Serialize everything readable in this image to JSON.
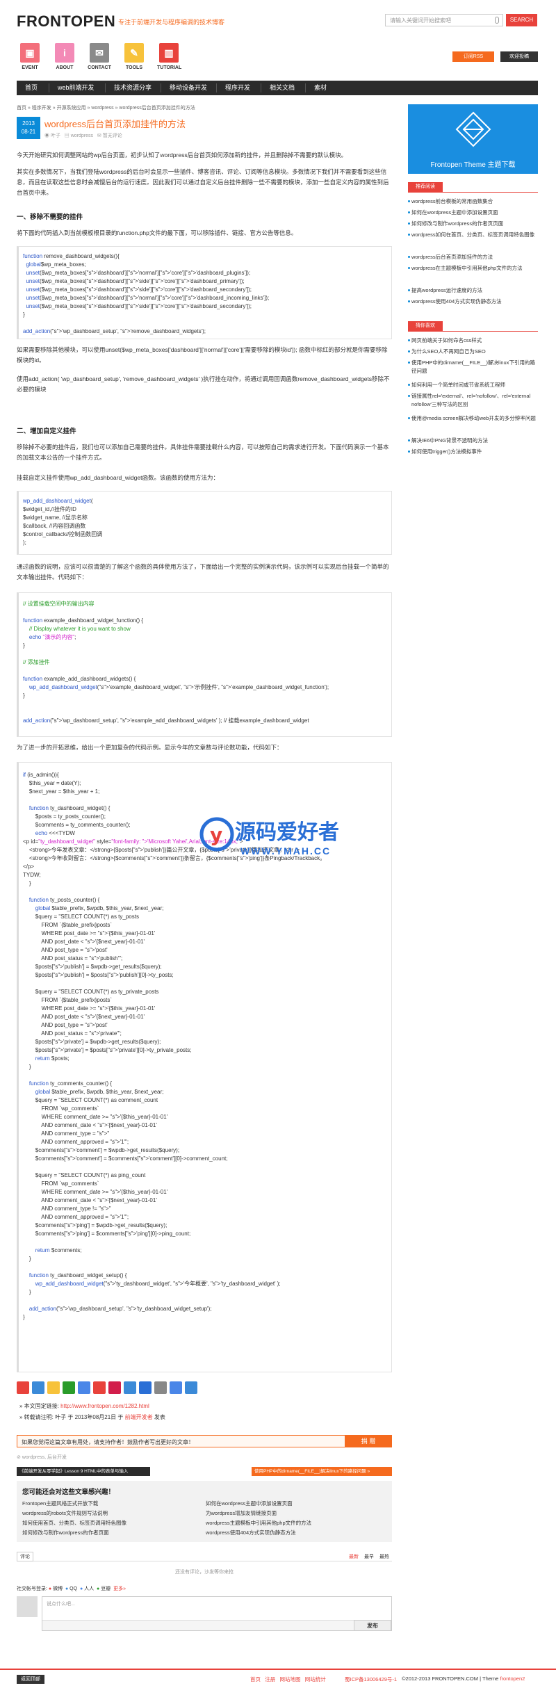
{
  "site": {
    "logo": "FRONTOPEN",
    "slogan": "专注于前端开发与程序编调的技术博客",
    "search_placeholder": "请输入关键词开始搜索吧",
    "search_btn": "SEARCH",
    "rss_btn": "订阅RSS",
    "contrib_btn": "欢迎投稿"
  },
  "icons": [
    {
      "label": "EVENT",
      "glyph": "▣",
      "color": "#f36f7b"
    },
    {
      "label": "ABOUT",
      "glyph": "i",
      "color": "#f38ab6"
    },
    {
      "label": "CONTACT",
      "glyph": "✉",
      "color": "#8a8a8a"
    },
    {
      "label": "TOOLS",
      "glyph": "✎",
      "color": "#f7c23b"
    },
    {
      "label": "TUTORIAL",
      "glyph": "▥",
      "color": "#e8423b"
    }
  ],
  "nav": [
    "首页",
    "web前端开发",
    "技术资源分享",
    "移动设备开发",
    "程序开发",
    "相关文档",
    "素材"
  ],
  "breadcrumb": "首页 » 程序开发 » 开源系统应用 » wordpress » wordpress后台首页添加挂件的方法",
  "post": {
    "year": "2013",
    "date": "08-21",
    "title": "wordpress后台首页添加挂件的方法",
    "author": "叶子",
    "category": "wordpress",
    "comments": "暂无评论"
  },
  "content": {
    "p1": "今天开始研究如何调整网站的wp后台页面，初步认知了wordpress后台首页如何添加新的挂件，并且删除掉不需要的默认模块。",
    "p2": "其实在多数情况下，当我们登陆wordpress的后台时会显示一些插件、博客咨讯、评论、订阅等信息模块。多数情况下我们并不需要看到这些信息，而且在读取这些信息时会减慢后台的运行速度。因此我们可以通过自定义后台挂件删除一些不需要的模块，添加一些自定义内容的属性到后台首页中来。",
    "h1": "一、移除不需要的挂件",
    "p3": "将下面的代码插入到当前模板根目录的function.php文件的最下面，可以移除插件、链接、官方公告等信息。",
    "code1": [
      "function remove_dashboard_widgets(){",
      "  global$wp_meta_boxes;",
      "  unset($wp_meta_boxes['dashboard']['normal']['core']['dashboard_plugins']);",
      "  unset($wp_meta_boxes['dashboard']['side']['core']['dashboard_primary']);",
      "  unset($wp_meta_boxes['dashboard']['side']['core']['dashboard_secondary']);",
      "  unset($wp_meta_boxes['dashboard']['normal']['core']['dashboard_incoming_links']);",
      "  unset($wp_meta_boxes['dashboard']['side']['core']['dashboard_secondary']);",
      "}",
      "",
      "add_action('wp_dashboard_setup', 'remove_dashboard_widgets');"
    ],
    "p4": "如果需要移除其他模块，可以使用unset($wp_meta_boxes['dashboard']['normal']['core']['需要移除的模块id']); 函数中标红的部分就是你需要移除模块的id。",
    "p5": "使用add_action( 'wp_dashboard_setup', 'remove_dashboard_widgets' )执行挂在动作，将通过调用回调函数remove_dashboard_widgets移除不必要的模块",
    "h2": "二、增加自定义挂件",
    "p6": "移除掉不必要的挂件后，我们也可以添加自己需要的挂件。具体挂件需要挂载什么内容，可以按照自己的需求进行开发。下面代码演示一个基本的加载文本公告的一个挂件方式。",
    "p7": "挂载自定义挂件使用wp_add_dashboard_widget函数。该函数的使用方法为：",
    "code2": [
      "wp_add_dashboard_widget(",
      "$widget_id,//挂件的ID",
      "$widget_name, //显示名称",
      "$callback, //内容回调函数",
      "$control_callback//控制函数回调",
      ");"
    ],
    "p8": "通过函数的说明，应该可以很清楚的了解这个函数的具体使用方法了，下面给出一个完整的实例演示代码，该示例可以实现后台挂载一个简单的文本输出挂件。代码如下：",
    "code3": [
      "// 设置挂载空间中的输出内容",
      "",
      "function example_dashboard_widget_function() {",
      "    // Display whatever it is you want to show",
      "    echo \"演示的内容\";",
      "}",
      "",
      "// 添加挂件",
      "",
      "function example_add_dashboard_widgets() {",
      "    wp_add_dashboard_widget('example_dashboard_widget', '示例挂件', 'example_dashboard_widget_function');",
      "}",
      "",
      "",
      "add_action('wp_dashboard_setup', 'example_add_dashboard_widgets' ); // 挂载example_dashboard_widget"
    ],
    "p9": "为了进一步的开拓思维，给出一个更加复杂的代码示例。显示今年的文章数与评论数功能，代码如下：",
    "code4": [
      "if (is_admin()){",
      "    $this_year = date(Y);",
      "    $next_year = $this_year + 1;",
      "",
      "    function ty_dashboard_widget() {",
      "        $posts = ty_posts_counter();",
      "        $comments = ty_comments_counter();",
      "        echo <<<TYDW",
      "<p id=\"ty_dashboard_widget\" style=\"font-family: 'Microsoft Yahei',Arial;font-size:14px;\">",
      "    <strong>今年发表文章：</strong>{$posts['publish']}篇公开文章，{$posts['private']}篇私密文章。<br />",
      "    <strong>今年收到留言：</strong>{$comments['comment']}条留言，{$comments['ping']}条Pingback/Trackback。",
      "</p>",
      "TYDW;",
      "    }",
      "",
      "    function ty_posts_counter() {",
      "        global $table_prefix, $wpdb, $this_year, $next_year;",
      "        $query = \"SELECT COUNT(*) as ty_posts",
      "            FROM `{$table_prefix}posts`",
      "            WHERE post_date >= '{$this_year}-01-01'",
      "            AND post_date < '{$next_year}-01-01'",
      "            AND post_type = 'post'",
      "            AND post_status = 'publish'\";",
      "        $posts['publish'] = $wpdb->get_results($query);",
      "        $posts['publish'] = $posts['publish'][0]->ty_posts;",
      "",
      "        $query = \"SELECT COUNT(*) as ty_private_posts",
      "            FROM `{$table_prefix}posts`",
      "            WHERE post_date >= '{$this_year}-01-01'",
      "            AND post_date < '{$next_year}-01-01'",
      "            AND post_type = 'post'",
      "            AND post_status = 'private'\";",
      "        $posts['private'] = $wpdb->get_results($query);",
      "        $posts['private'] = $posts['private'][0]->ty_private_posts;",
      "        return $posts;",
      "    }",
      "",
      "    function ty_comments_counter() {",
      "        global $table_prefix, $wpdb, $this_year, $next_year;",
      "        $query = \"SELECT COUNT(*) as comment_count",
      "            FROM `wp_comments`",
      "            WHERE comment_date >= '{$this_year}-01-01'",
      "            AND comment_date < '{$next_year}-01-01'",
      "            AND comment_type = ''",
      "            AND comment_approved = '1'\";",
      "        $comments['comment'] = $wpdb->get_results($query);",
      "        $comments['comment'] = $comments['comment'][0]->comment_count;",
      "",
      "        $query = \"SELECT COUNT(*) as ping_count",
      "            FROM `wp_comments`",
      "            WHERE comment_date >= '{$this_year}-01-01'",
      "            AND comment_date < '{$next_year}-01-01'",
      "            AND comment_type != ''",
      "            AND comment_approved = '1'\";",
      "        $comments['ping'] = $wpdb->get_results($query);",
      "        $comments['ping'] = $comments['ping'][0]->ping_count;",
      "",
      "        return $comments;",
      "    }",
      "",
      "    function ty_dashboard_widget_setup() {",
      "        wp_add_dashboard_widget('ty_dashboard_widget', '今年概要', 'ty_dashboard_widget' );",
      "    }",
      "",
      "    add_action('wp_dashboard_setup', 'ty_dashboard_widget_setup');",
      "}"
    ]
  },
  "watermark": {
    "main": "源码爱好者",
    "sub": "WWW.YMAH.CC"
  },
  "footer_links": {
    "orig_label": "» 本文固定链接:",
    "orig_url": "http://www.frontopen.com/1282.html",
    "reprint_label": "» 转载请注明:",
    "reprint_text": "叶子 于 2013年08月21日 于",
    "reprint_site": "前端开发者",
    "reprint_end": "发表"
  },
  "subscribe": {
    "placeholder": "如果您觉得这篇文章有用处，请支持作者！鼓励作者写出更好的文章！",
    "btn": "捐 赠"
  },
  "tags": "wordpress, 后台开发",
  "prevnext": {
    "prev": "《前端开发从零学起》Lesson 9 HTML中的表单与输入",
    "next": "使用PHP中的dirname(__FILE__)解决linux下的路径问题 »"
  },
  "related": {
    "title": "您可能还会对这些文章感兴趣！",
    "left": [
      "Frontopen主题风格正式开放下载",
      "wordpress的robots文件规则写法说明",
      "如何使用首页、分类页、标签页调用特色图像",
      "如何修改与制作wordpress的作者页面"
    ],
    "right": [
      "如何在wordpress主题中添加设置页面",
      "为wordpress增加友情链接页面",
      "wordpress主题模板中引用其他php文件的方法",
      "wordpress使用404方式实现伪静态方法"
    ]
  },
  "comment_bar": {
    "left": "评论",
    "right1": "最新",
    "right2": "最早",
    "right3": "最热"
  },
  "empty": "还没有评论，沙发等你来抢",
  "social": {
    "label": "社交帐号登录:",
    "items": [
      "微博",
      "QQ",
      "人人",
      "豆瓣",
      "更多»"
    ]
  },
  "reply": {
    "placeholder": "说点什么吧...",
    "btn": "发布"
  },
  "bottom": {
    "left_btn": "返回顶部",
    "links": "首页   注册   网站地图   网站统计",
    "icp": "蜀ICP备13006429号-1",
    "copy": "©2012-2013 FRONTOPEN.COM | Theme",
    "theme": "frontopen2"
  },
  "sidebar": {
    "banner": "Frontopen Theme 主题下载",
    "h1": "推荐阅读",
    "list1": [
      "wordpress前台模板的常用函数集合",
      "如何在wordpress主题中添加设置页面",
      "如何修改与制作wordpress的作者页页面",
      "wordpress如何在首页、分类页、标签页调用特色图像",
      "wordpress后台首页添加挂件的方法",
      "wordpress在主题模板中引用其他php文件的方法",
      "提高wordpress运行速度的方法",
      "wordpress使用404方式实现伪静态方法"
    ],
    "h2": "猜你喜欢",
    "list2": [
      "网页前端关于如何命名css样式",
      "为什么SEO人不再网自己为SEO",
      "使用PHP中的dirname(__FILE__)解决linux下引用的路径问题",
      "如何利用一个简单时间或节省系统工程师",
      "链接属性rel='external'、rel='nofollow'、rel='external nofollow'三种写法的区别",
      "使用@media screen解决移动web开发的多分辨率问题",
      "解决IE6中PNG背景不透明的方法",
      "如何使用trigger()方法模拟事件"
    ]
  },
  "colors": {
    "accent": "#f56a1e",
    "red": "#e8423b",
    "blue": "#0a8bd8",
    "nav": "#2b2b2b"
  }
}
